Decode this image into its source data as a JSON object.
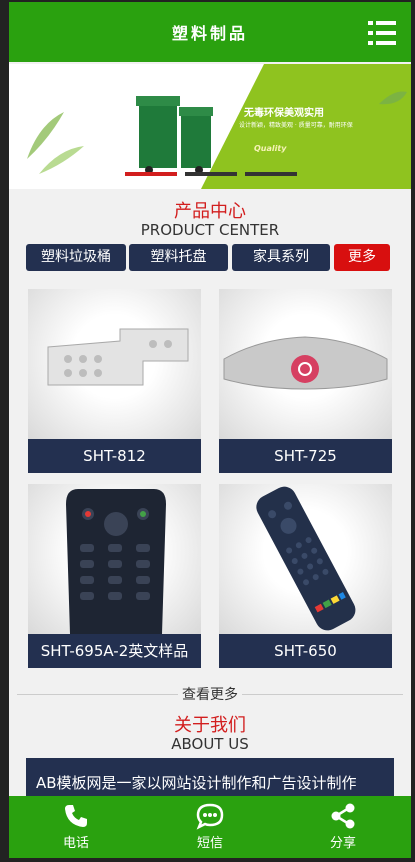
{
  "header": {
    "title": "塑料制品",
    "menu_icon": "hamburger-menu-icon"
  },
  "banner": {
    "headline": "无毒环保美观实用",
    "small_text": "设计新颖，精致美观 · 质量可靠，耐用环保",
    "quality": "Quality",
    "active_slide": 1,
    "slide_count": 3,
    "accent_color": "#8fc31f",
    "active_dot_color": "#d21e1e"
  },
  "products": {
    "title_cn": "产品中心",
    "title_en": "PRODUCT CENTER",
    "categories": [
      "塑料垃圾桶",
      "塑料托盘",
      "家具系列"
    ],
    "more_label": "更多",
    "items": [
      {
        "name": "SHT-812"
      },
      {
        "name": "SHT-725"
      },
      {
        "name": "SHT-695A-2英文样品"
      },
      {
        "name": "SHT-650"
      }
    ],
    "view_more": "查看更多"
  },
  "about": {
    "title_cn": "关于我们",
    "title_en": "ABOUT US",
    "text": "AB模板网是一家以网站设计制作和广告设计制作"
  },
  "bottom_nav": [
    {
      "label": "电话",
      "icon": "phone-icon"
    },
    {
      "label": "短信",
      "icon": "message-icon"
    },
    {
      "label": "分享",
      "icon": "share-icon"
    }
  ],
  "colors": {
    "primary_green": "#2aa10f",
    "navy": "#233050",
    "red": "#d80f0f"
  }
}
